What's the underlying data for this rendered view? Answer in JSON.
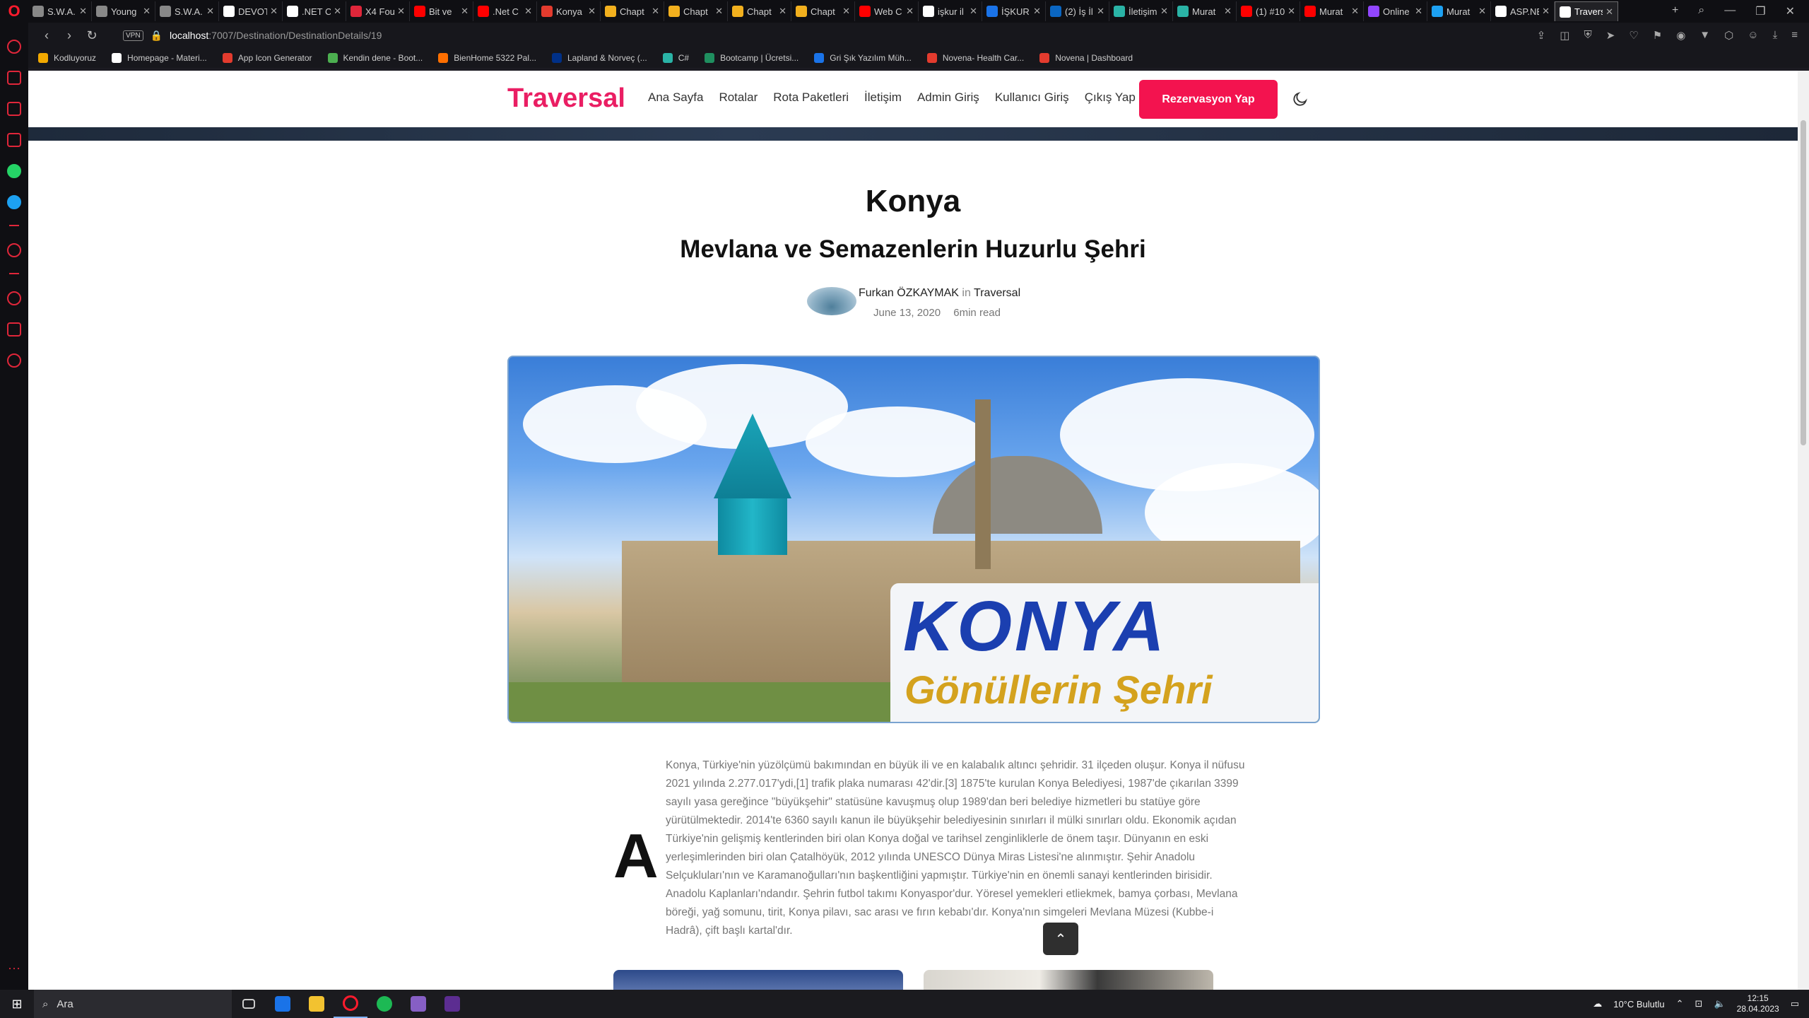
{
  "browser": {
    "tabs": [
      {
        "label": "S.W.A.",
        "color": "#888888"
      },
      {
        "label": "Young",
        "color": "#888888"
      },
      {
        "label": "S.W.A.",
        "color": "#888888"
      },
      {
        "label": "DEVOT",
        "color": "#ffffff"
      },
      {
        "label": ".NET C",
        "color": "#ffffff"
      },
      {
        "label": "X4 Fou",
        "color": "#e0263a"
      },
      {
        "label": "Bit ve",
        "color": "#ff0000"
      },
      {
        "label": ".Net C",
        "color": "#ff0000"
      },
      {
        "label": "Konya",
        "color": "#e33b2e"
      },
      {
        "label": "Chapt",
        "color": "#f2b01e"
      },
      {
        "label": "Chapt",
        "color": "#f2b01e"
      },
      {
        "label": "Chapt",
        "color": "#f2b01e"
      },
      {
        "label": "Chapt",
        "color": "#f2b01e"
      },
      {
        "label": "Web C",
        "color": "#ff0000"
      },
      {
        "label": "işkur il",
        "color": "#ffffff"
      },
      {
        "label": "İŞKUR",
        "color": "#1a73e8"
      },
      {
        "label": "(2) İş İl",
        "color": "#0a66c2"
      },
      {
        "label": "İletişim",
        "color": "#2ab3a6"
      },
      {
        "label": "Murat",
        "color": "#2ab3a6"
      },
      {
        "label": "(1) #10",
        "color": "#ff0000"
      },
      {
        "label": "Murat",
        "color": "#ff0000"
      },
      {
        "label": "Online",
        "color": "#9146ff"
      },
      {
        "label": "Murat",
        "color": "#1da1f2"
      },
      {
        "label": "ASP.NE",
        "color": "#ffffff"
      },
      {
        "label": "Travers",
        "color": "#ffffff",
        "active": true
      }
    ],
    "url_host": "localhost",
    "url_path": ":7007/Destination/DestinationDetails/19",
    "vpn_label": "VPN",
    "bookmarks": [
      {
        "label": "Kodluyoruz",
        "color": "#f2a900"
      },
      {
        "label": "Homepage - Materi...",
        "color": "#ffffff"
      },
      {
        "label": "App Icon Generator",
        "color": "#e33b2e"
      },
      {
        "label": "Kendin dene - Boot...",
        "color": "#4caf50"
      },
      {
        "label": "BienHome 5322 Pal...",
        "color": "#ff6f00"
      },
      {
        "label": "Lapland & Norveç (...",
        "color": "#003087"
      },
      {
        "label": "C#",
        "color": "#2ab3a6"
      },
      {
        "label": "Bootcamp | Ücretsi...",
        "color": "#1f8f5f"
      },
      {
        "label": "Gri Şık Yazılım Müh...",
        "color": "#1a73e8"
      },
      {
        "label": "Novena- Health Car...",
        "color": "#e33b2e"
      },
      {
        "label": "Novena | Dashboard",
        "color": "#e33b2e"
      }
    ]
  },
  "site": {
    "brand": "Traversal",
    "menu": [
      "Ana Sayfa",
      "Rotalar",
      "Rota Paketleri",
      "İletişim",
      "Admin Giriş",
      "Kullanıcı Giriş",
      "Çıkış Yap"
    ],
    "reserve_label": "Rezervasyon Yap",
    "accent": "#f3134f",
    "brand_color": "#ea1e63"
  },
  "article": {
    "title": "Konya",
    "subtitle": "Mevlana ve Semazenlerin Huzurlu Şehri",
    "author": "Furkan ÖZKAYMAK",
    "in_word": "in",
    "category": "Traversal",
    "date": "June 13, 2020",
    "read_time": "6min read",
    "hero_sign_top": "KONYA",
    "hero_sign_bottom": "Gönüllerin Şehri",
    "dropcap": "A",
    "body": "Konya, Türkiye'nin yüzölçümü bakımından en büyük ili ve en kalabalık altıncı şehridir. 31 ilçeden oluşur. Konya il nüfusu 2021 yılında 2.277.017'ydi,[1] trafik plaka numarası 42'dir.[3] 1875'te kurulan Konya Belediyesi, 1987'de çıkarılan 3399 sayılı yasa gereğince \"büyükşehir\" statüsüne kavuşmuş olup 1989'dan beri belediye hizmetleri bu statüye göre yürütülmektedir. 2014'te 6360 sayılı kanun ile büyükşehir belediyesinin sınırları il mülki sınırları oldu. Ekonomik açıdan Türkiye'nin gelişmiş kentlerinden biri olan Konya doğal ve tarihsel zenginliklerle de önem taşır. Dünyanın en eski yerleşimlerinden biri olan Çatalhöyük, 2012 yılında UNESCO Dünya Miras Listesi'ne alınmıştır. Şehir Anadolu Selçukluları'nın ve Karamanoğulları'nın başkentliğini yapmıştır. Türkiye'nin en önemli sanayi kentlerinden birisidir. Anadolu Kaplanları'ndandır. Şehrin futbol takımı Konyaspor'dur. Yöresel yemekleri etliekmek, bamya çorbası, Mevlana böreği, yağ somunu, tirit, Konya pilavı, sac arası ve fırın kebabı'dır. Konya'nın simgeleri Mevlana Müzesi (Kubbe-i Hadrâ), çift başlı kartal'dır."
  },
  "taskbar": {
    "search_placeholder": "Ara",
    "weather": "10°C  Bulutlu",
    "time": "12:15",
    "date": "28.04.2023"
  }
}
